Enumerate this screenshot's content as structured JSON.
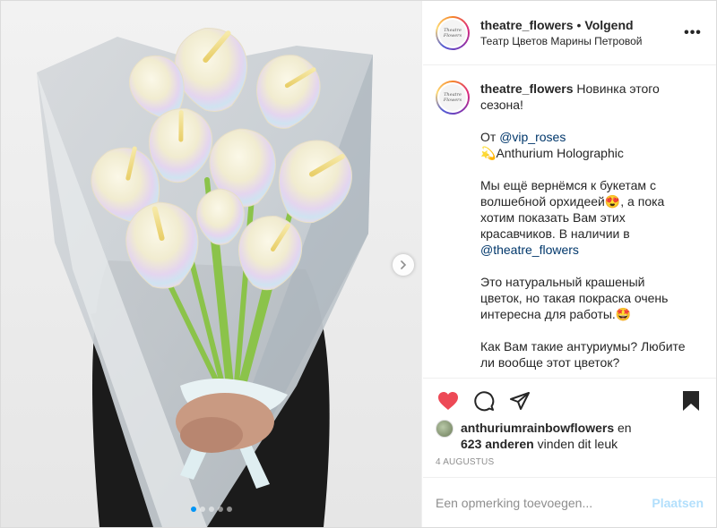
{
  "header": {
    "username": "theatre_flowers",
    "separator": "•",
    "follow_label": "Volgend",
    "location": "Театр Цветов Марины Петровой",
    "more_label": "•••",
    "avatar_text": "Theatre Flowers"
  },
  "caption": {
    "username": "theatre_flowers",
    "line1": " Новинка этого сезона!",
    "from_prefix": "От ",
    "from_link": "@vip_roses",
    "emoji_bouquet": "💫",
    "product": "Anthurium Holographic",
    "para2_a": "Мы ещё вернёмся к букетам с волшебной орхидеей",
    "emoji_love": "😍",
    "para2_b": ", а пока хотим показать Вам этих красавчиков. В наличии в ",
    "para2_link": "@theatre_flowers",
    "para3": "Это натуральный крашеный цветок, но такая покраска очень интересна для работы.",
    "emoji_star": "🤩",
    "para4": "Как Вам такие антуриумы? Любите ли вообще этот цветок?",
    "faded": "10"
  },
  "likes": {
    "user": "anthuriumrainbowflowers",
    "and": " en",
    "count": "623 anderen",
    "suffix": " vinden dit leuk"
  },
  "date": "4 AUGUSTUS",
  "comment": {
    "placeholder": "Een opmerking toevoegen...",
    "post_label": "Plaatsen"
  },
  "carousel": {
    "count": 5,
    "active_index": 0
  },
  "colors": {
    "heart": "#ed4956",
    "link": "#00376b",
    "post_button": "#b2dffc",
    "active_dot": "#0095f6"
  },
  "icons": [
    "heart-icon",
    "comment-icon",
    "share-icon",
    "bookmark-icon",
    "chevron-right-icon",
    "more-icon"
  ]
}
